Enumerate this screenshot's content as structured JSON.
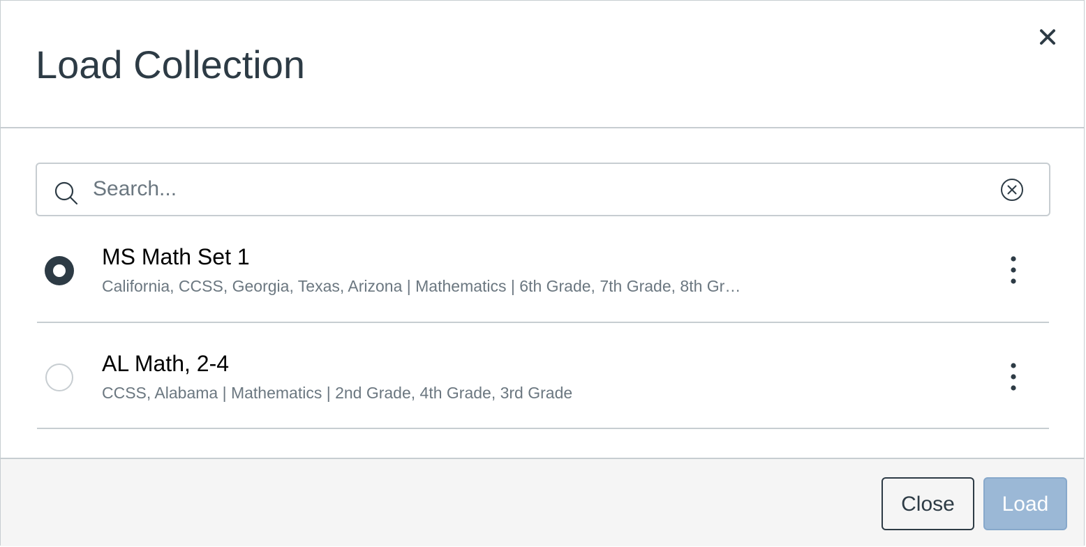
{
  "dialog": {
    "title": "Load Collection",
    "close_icon": "close-icon"
  },
  "search": {
    "placeholder": "Search...",
    "value": "",
    "search_icon": "search-icon",
    "clear_icon": "clear-circle-icon"
  },
  "collections": [
    {
      "name": "MS Math Set 1",
      "description": "California, CCSS, Georgia, Texas, Arizona | Mathematics | 6th Grade, 7th Grade, 8th Gr…",
      "selected": true,
      "menu_icon": "more-vertical-icon"
    },
    {
      "name": "AL Math, 2-4",
      "description": "CCSS, Alabama | Mathematics | 2nd Grade, 4th Grade, 3rd Grade",
      "selected": false,
      "menu_icon": "more-vertical-icon"
    }
  ],
  "footer": {
    "close_label": "Close",
    "load_label": "Load"
  },
  "colors": {
    "text": "#2d3b45",
    "muted_text": "#6b7780",
    "border": "#c7cdd1",
    "footer_bg": "#f5f5f5",
    "load_button_disabled": "#9bb8d6"
  }
}
